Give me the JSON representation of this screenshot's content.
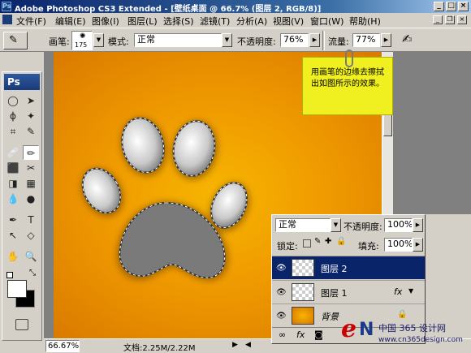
{
  "window": {
    "app_badge": "Ps",
    "title": "Adobe Photoshop CS3 Extended - [壁纸桌面 @ 66.7% (图层 2, RGB/8)]",
    "minimize": "_",
    "maximize": "□",
    "close": "×"
  },
  "menu": [
    "文件(F)",
    "编辑(E)",
    "图像(I)",
    "图层(L)",
    "选择(S)",
    "滤镜(T)",
    "分析(A)",
    "视图(V)",
    "窗口(W)",
    "帮助(H)"
  ],
  "options": {
    "brush_label": "画笔:",
    "brush_size": "175",
    "mode_label": "模式:",
    "mode_value": "正常",
    "opacity_label": "不透明度:",
    "opacity_value": "76%",
    "flow_label": "流量:",
    "flow_value": "77%"
  },
  "toolbox": {
    "logo": "Ps",
    "tools": [
      "◯",
      "➤",
      "ϕ",
      "✦",
      "⌗",
      "✎",
      "🩹",
      "✏",
      "⬛",
      "✂",
      "◨",
      "▦",
      "💧",
      "●",
      "✒",
      "T",
      "↖",
      "◇",
      "✋",
      "🔍"
    ]
  },
  "callout": {
    "text": "用画笔的边缘去擦拭出如图所示的效果。"
  },
  "status": {
    "zoom": "66.67%",
    "doc": "文档:2.25M/2.22M"
  },
  "layers_panel": {
    "blend_mode": "正常",
    "opacity_label": "不透明度:",
    "opacity_value": "100%",
    "lock_label": "锁定:",
    "fill_label": "填充:",
    "fill_value": "100%",
    "layers": [
      {
        "name": "图层 2",
        "selected": true,
        "fx": false,
        "locked": false
      },
      {
        "name": "图层 1",
        "selected": false,
        "fx": true,
        "locked": false
      },
      {
        "name": "背景",
        "selected": false,
        "fx": false,
        "locked": true
      }
    ],
    "fx_label": "fx"
  },
  "watermark": {
    "logo_e": "e",
    "logo_n": "N",
    "site_name": "中国 365 设计网",
    "url": "www.cn365design.com"
  }
}
